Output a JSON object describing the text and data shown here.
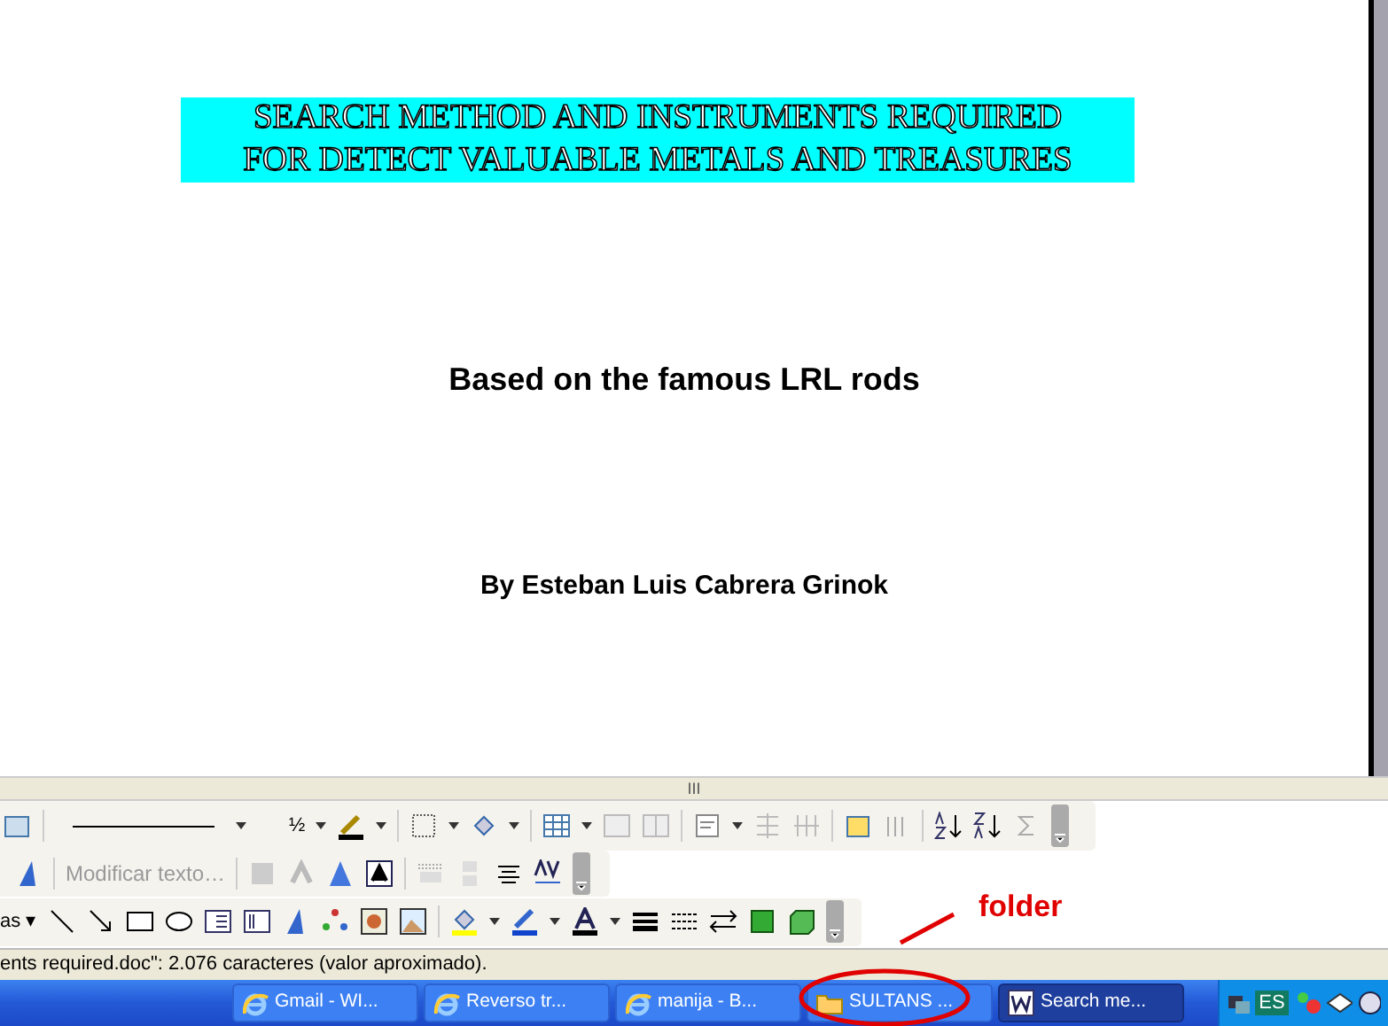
{
  "document": {
    "title_lines": [
      "SEARCH METHOD AND INSTRUMENTS REQUIRED",
      "FOR DETECT VALUABLE METALS AND TREASURES"
    ],
    "subtitle": "Based on the famous LRL rods",
    "author": "By Esteban Luis Cabrera Grinok"
  },
  "splitter": {
    "grip": "III"
  },
  "toolbars": {
    "line_weight": "½",
    "wordart_edit": {
      "label": "Modificar texto…",
      "disabled": true
    },
    "draw_menu": "as ▾"
  },
  "status_bar": {
    "text": "ents required.doc\": 2.076 caracteres (valor aproximado)."
  },
  "taskbar": {
    "buttons": [
      {
        "label": "Gmail - WI...",
        "kind": "browser",
        "selected": false
      },
      {
        "label": "Reverso tr...",
        "kind": "browser",
        "selected": false
      },
      {
        "label": "manija - B...",
        "kind": "browser",
        "selected": false
      },
      {
        "label": "SULTANS ...",
        "kind": "folder",
        "selected": false
      },
      {
        "label": "Search me...",
        "kind": "word",
        "selected": true
      }
    ],
    "language": "ES"
  },
  "annotation": {
    "label": "folder"
  }
}
